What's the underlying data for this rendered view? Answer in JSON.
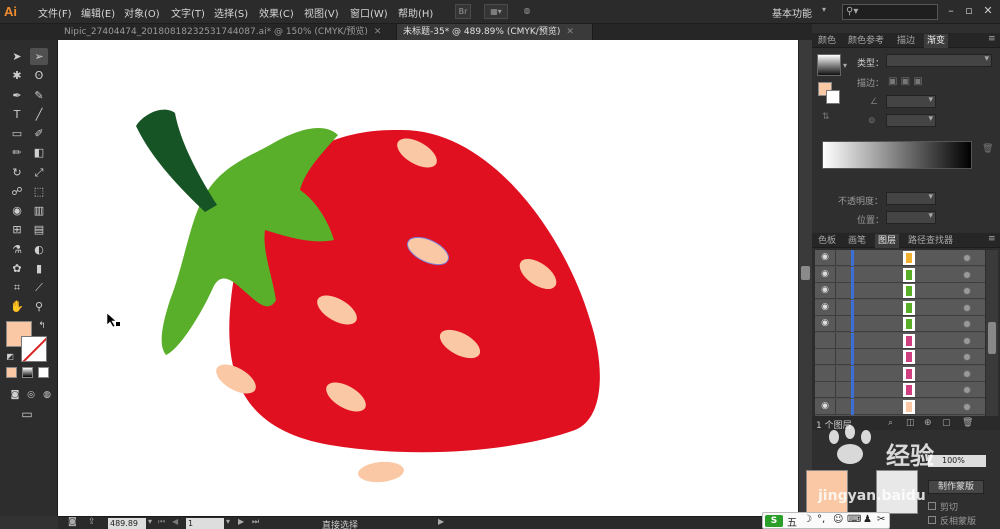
{
  "app": {
    "logo": "Ai"
  },
  "menu": [
    "文件(F)",
    "编辑(E)",
    "对象(O)",
    "文字(T)",
    "选择(S)",
    "效果(C)",
    "视图(V)",
    "窗口(W)",
    "帮助(H)"
  ],
  "menubar_icons": {
    "bridge": "Br"
  },
  "workspace": "基本功能",
  "document_tabs": [
    {
      "label": "Nipic_27404474_20180818232531744087.ai* @ 150% (CMYK/预览)",
      "active": false
    },
    {
      "label": "未标题-35* @ 489.89% (CMYK/预览)",
      "active": true
    }
  ],
  "tools": [
    "selection-tool",
    "direct-selection-tool",
    "magic-wand-tool",
    "lasso-tool",
    "pen-tool",
    "curvature-tool",
    "type-tool",
    "line-tool",
    "rectangle-tool",
    "paintbrush-tool",
    "pencil-tool",
    "eraser-tool",
    "rotate-tool",
    "scale-tool",
    "warp-tool",
    "free-transform-tool",
    "shape-builder-tool",
    "chart-tool",
    "mesh-tool",
    "gradient-tool",
    "eyedropper-tool",
    "blend-tool",
    "symbol-sprayer-tool",
    "column-graph-tool",
    "artboard-tool",
    "slice-tool",
    "hand-tool",
    "zoom-tool"
  ],
  "colors": {
    "fill": "#fac8a4",
    "stroke": "#ffffff",
    "strawberry": "#e01020",
    "leaves": "#5aaf2a",
    "stem": "#175425",
    "seeds": "#fac8a4"
  },
  "gradient_panel": {
    "tabs": [
      "颜色",
      "颜色参考",
      "描边",
      "渐变"
    ],
    "type_label": "类型：",
    "stroke_label": "描边：",
    "opacity_label": "不透明度：",
    "position_label": "位置："
  },
  "layers_panel": {
    "tabs": [
      "色板",
      "画笔",
      "图层",
      "路径查找器"
    ],
    "count_label": "1 个图层",
    "rows": [
      {
        "visible": true,
        "thumb": "#f0b030"
      },
      {
        "visible": true,
        "thumb": "#5aaf2a"
      },
      {
        "visible": true,
        "thumb": "#5aaf2a"
      },
      {
        "visible": true,
        "thumb": "#5aaf2a"
      },
      {
        "visible": true,
        "thumb": "#5aaf2a"
      },
      {
        "visible": false,
        "thumb": "#d04080"
      },
      {
        "visible": false,
        "thumb": "#d04080"
      },
      {
        "visible": false,
        "thumb": "#d04080"
      },
      {
        "visible": false,
        "thumb": "#d04080"
      },
      {
        "visible": true,
        "thumb": "#fac8a4"
      }
    ]
  },
  "transparency_panel": {
    "opacity_value": "100%",
    "mask_button": "制作蒙版",
    "clip_label": "剪切",
    "invert_label": "反相蒙版"
  },
  "status": {
    "zoom": "489.89",
    "page": "1",
    "tool_name": "直接选择"
  },
  "watermark": "jingyan.baidu",
  "ime": {
    "logo": "S",
    "mode": "五"
  }
}
